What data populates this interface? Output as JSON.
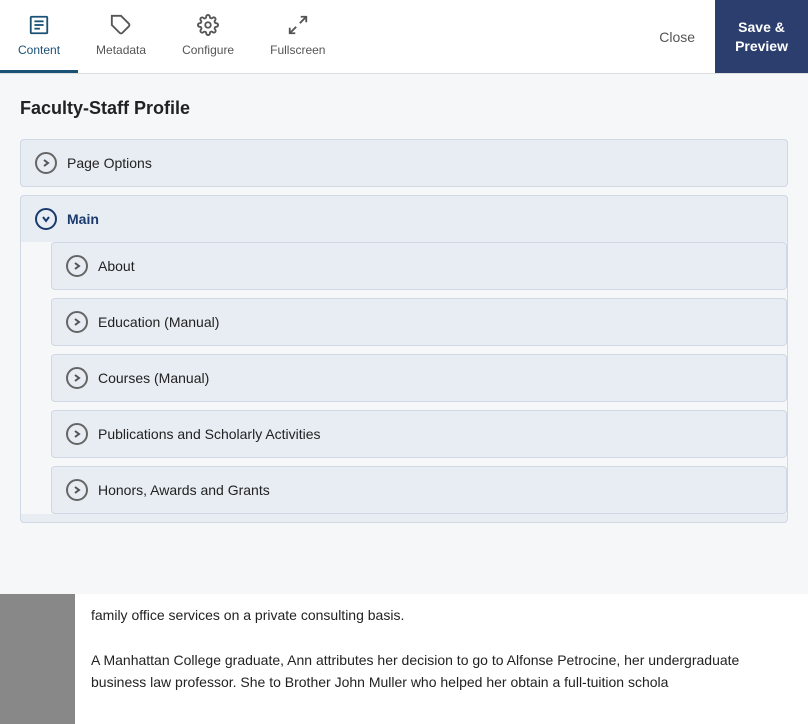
{
  "toolbar": {
    "items": [
      {
        "id": "content",
        "label": "Content",
        "active": true
      },
      {
        "id": "metadata",
        "label": "Metadata",
        "active": false
      },
      {
        "id": "configure",
        "label": "Configure",
        "active": false
      },
      {
        "id": "fullscreen",
        "label": "Fullscreen",
        "active": false
      }
    ],
    "close_label": "Close",
    "save_label": "Save &\nPreview"
  },
  "page": {
    "title": "Faculty-Staff Profile"
  },
  "accordion": {
    "items": [
      {
        "id": "page-options",
        "label": "Page Options",
        "open": false,
        "children": []
      },
      {
        "id": "main",
        "label": "Main",
        "open": true,
        "children": [
          {
            "id": "about",
            "label": "About"
          },
          {
            "id": "education",
            "label": "Education (Manual)"
          },
          {
            "id": "courses",
            "label": "Courses (Manual)"
          },
          {
            "id": "publications",
            "label": "Publications and Scholarly Activities"
          },
          {
            "id": "honors",
            "label": "Honors, Awards and Grants"
          }
        ]
      }
    ]
  },
  "preview": {
    "text1": "family office services on a private consulting basis.",
    "text2": "A Manhattan College graduate, Ann attributes her decision to go to Alfonse Petrocine, her undergraduate business law professor.  She to Brother John Muller who helped her obtain a full-tuition schola"
  },
  "icons": {
    "content": "▤",
    "metadata": "⬟",
    "configure": "⚙",
    "fullscreen": "⛶"
  }
}
